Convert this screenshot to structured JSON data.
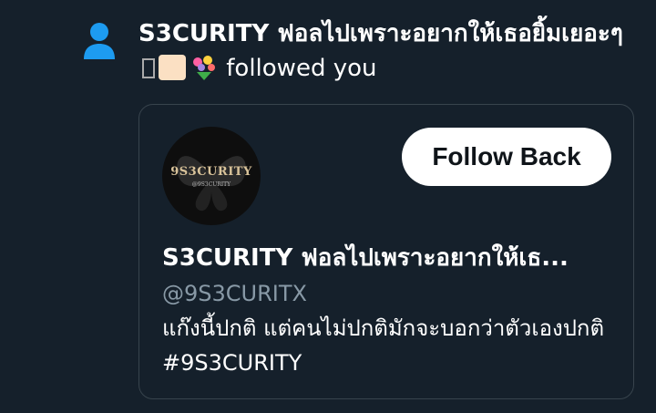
{
  "notification": {
    "icon": "person-icon",
    "display_name": "S3CURITY ฟอลไปเพราะอยากให้เธอยิ้มเยอะๆ",
    "action_text": "followed you"
  },
  "card": {
    "avatar_text": "9S3CURITY",
    "avatar_subtext": "@9S3CURITY",
    "follow_back_label": "Follow Back",
    "name": "S3CURITY ฟอลไปเพราะอยากให้เธ...",
    "handle": "@9S3CURITX",
    "bio": "แก๊งนี้ปกติ แต่คนไม่ปกติมักจะบอกว่าตัวเองปกติ #9S3CURITY"
  },
  "colors": {
    "background": "#15202b",
    "accent": "#1d9bf0",
    "card_border": "#38444d",
    "muted_text": "#8899a6"
  }
}
